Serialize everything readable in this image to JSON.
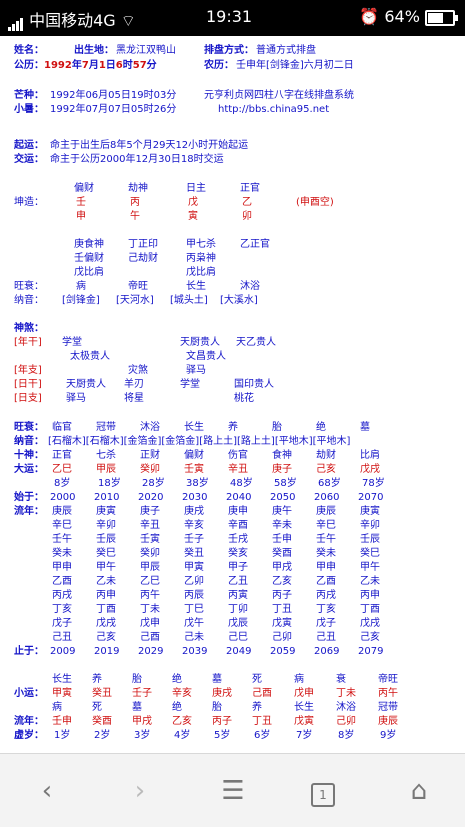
{
  "status": {
    "carrier": "中国移动4G",
    "time": "19:31",
    "battery": "64%",
    "battery_level": 0.64
  },
  "header": {
    "row1": {
      "name_label": "姓名：",
      "birthplace_label": "出生地：",
      "birthplace": "黑龙江双鸭山",
      "method_label": "排盘方式：",
      "method": "普通方式排盘"
    },
    "row2": {
      "label": "公历：",
      "y": "1992",
      "yu": "年",
      "m": "7",
      "mu": "月",
      "d": "1",
      "du": "日",
      "h": "6",
      "hu": "时",
      "mi": "57",
      "miu": "分",
      "nongli_label": "农历：",
      "nongli": "壬申年[剑锋金]六月初二日"
    },
    "row3": {
      "label": "芒种：",
      "value": "1992年06月05日19时03分",
      "site": "元亨利贞网四柱八字在线排盘系统"
    },
    "row4": {
      "label": "小暑：",
      "value": "1992年07月07日05时26分",
      "url": "http://bbs.china95.net"
    },
    "row5": {
      "label": "起运：",
      "value": "命主于出生后8年5个月29天12小时开始起运"
    },
    "row6": {
      "label": "交运：",
      "value": "命主于公历2000年12月30日18时交运"
    }
  },
  "pillars": {
    "tengods": [
      "偏财",
      "劫神",
      "日主",
      "正官"
    ],
    "qiankun_label": "坤造：",
    "stems": [
      "壬",
      "丙",
      "戊",
      "乙"
    ],
    "branches": [
      "申",
      "午",
      "寅",
      "卯"
    ],
    "kongwang": "(申酉空)",
    "hidden": [
      [
        "庚食神",
        "壬偏财",
        "戊比肩"
      ],
      [
        "丁正印",
        "己劫财"
      ],
      [
        "甲七杀",
        "丙枭神",
        "戊比肩"
      ],
      [
        "乙正官"
      ]
    ],
    "wangshuai_label": "旺衰：",
    "wangshuai": [
      "病",
      "帝旺",
      "长生",
      "沐浴"
    ],
    "nayin_label": "纳音：",
    "nayin": [
      "[剑锋金]",
      "[天河水]",
      "[城头土]",
      "[大溪水]"
    ]
  },
  "shensha": {
    "title": "神煞：",
    "nian_gan_label": "[年干]",
    "nian_gan_items": [
      "学堂",
      "天厨贵人",
      "天乙贵人",
      "太极贵人",
      "文昌贵人"
    ],
    "nian_zhi_label": "[年支]",
    "nian_zhi_items": [
      "灾煞",
      "驿马"
    ],
    "ri_gan_label": "[日干]",
    "ri_gan_items": [
      "天厨贵人",
      "羊刃",
      "学堂",
      "国印贵人"
    ],
    "ri_zhi_label": "[日支]",
    "ri_zhi_items": [
      "驿马",
      "将星",
      "桃花"
    ]
  },
  "dayun": {
    "wangshuai_label": "旺衰：",
    "wangshuai": [
      "临官",
      "冠带",
      "沐浴",
      "长生",
      "养",
      "胎",
      "绝",
      "墓"
    ],
    "nayin_label": "纳音：",
    "nayin_line": "[石榴木][石榴木][金箔金][金箔金][路上土][路上土][平地木][平地木]",
    "shishen_label": "十神：",
    "shishen": [
      "正官",
      "七杀",
      "正财",
      "偏财",
      "伤官",
      "食神",
      "劫财",
      "比肩"
    ],
    "dayun_label": "大运：",
    "dayun": [
      "乙巳",
      "甲辰",
      "癸卯",
      "壬寅",
      "辛丑",
      "庚子",
      "己亥",
      "戊戌"
    ],
    "ages": [
      "8岁",
      "18岁",
      "28岁",
      "38岁",
      "48岁",
      "58岁",
      "68岁",
      "78岁"
    ],
    "start_label": "始于：",
    "start_years": [
      "2000",
      "2010",
      "2020",
      "2030",
      "2040",
      "2050",
      "2060",
      "2070"
    ],
    "liunian_label": "流年：",
    "liunian": [
      [
        "庚辰",
        "庚寅",
        "庚子",
        "庚戌",
        "庚申",
        "庚午",
        "庚辰",
        "庚寅"
      ],
      [
        "辛巳",
        "辛卯",
        "辛丑",
        "辛亥",
        "辛酉",
        "辛未",
        "辛巳",
        "辛卯"
      ],
      [
        "壬午",
        "壬辰",
        "壬寅",
        "壬子",
        "壬戌",
        "壬申",
        "壬午",
        "壬辰"
      ],
      [
        "癸未",
        "癸巳",
        "癸卯",
        "癸丑",
        "癸亥",
        "癸酉",
        "癸未",
        "癸巳"
      ],
      [
        "甲申",
        "甲午",
        "甲辰",
        "甲寅",
        "甲子",
        "甲戌",
        "甲申",
        "甲午"
      ],
      [
        "乙酉",
        "乙未",
        "乙巳",
        "乙卯",
        "乙丑",
        "乙亥",
        "乙酉",
        "乙未"
      ],
      [
        "丙戌",
        "丙申",
        "丙午",
        "丙辰",
        "丙寅",
        "丙子",
        "丙戌",
        "丙申"
      ],
      [
        "丁亥",
        "丁酉",
        "丁未",
        "丁巳",
        "丁卯",
        "丁丑",
        "丁亥",
        "丁酉"
      ],
      [
        "戊子",
        "戊戌",
        "戊申",
        "戊午",
        "戊辰",
        "戊寅",
        "戊子",
        "戊戌"
      ],
      [
        "己丑",
        "己亥",
        "己酉",
        "己未",
        "己巳",
        "己卯",
        "己丑",
        "己亥"
      ]
    ],
    "end_label": "止于：",
    "end_years": [
      "2009",
      "2019",
      "2029",
      "2039",
      "2049",
      "2059",
      "2069",
      "2079"
    ]
  },
  "xiaoyun": {
    "states_top": [
      "长生",
      "养",
      "胎",
      "绝",
      "墓",
      "死",
      "病",
      "衰",
      "帝旺"
    ],
    "label": "小运：",
    "values": [
      "甲寅",
      "癸丑",
      "壬子",
      "辛亥",
      "庚戌",
      "己酉",
      "戊申",
      "丁未",
      "丙午"
    ],
    "states_bottom": [
      "病",
      "死",
      "墓",
      "绝",
      "胎",
      "养",
      "长生",
      "沐浴",
      "冠带"
    ],
    "liunian_label": "流年：",
    "liunian": [
      "壬申",
      "癸酉",
      "甲戌",
      "乙亥",
      "丙子",
      "丁丑",
      "戊寅",
      "己卯",
      "庚辰"
    ],
    "xusui_label": "虚岁：",
    "xusui": [
      "1岁",
      "2岁",
      "3岁",
      "4岁",
      "5岁",
      "6岁",
      "7岁",
      "8岁",
      "9岁"
    ]
  },
  "nav": {
    "back": "‹",
    "forward": "›",
    "menu": "☰",
    "tabs": "1",
    "home": "⌂"
  }
}
